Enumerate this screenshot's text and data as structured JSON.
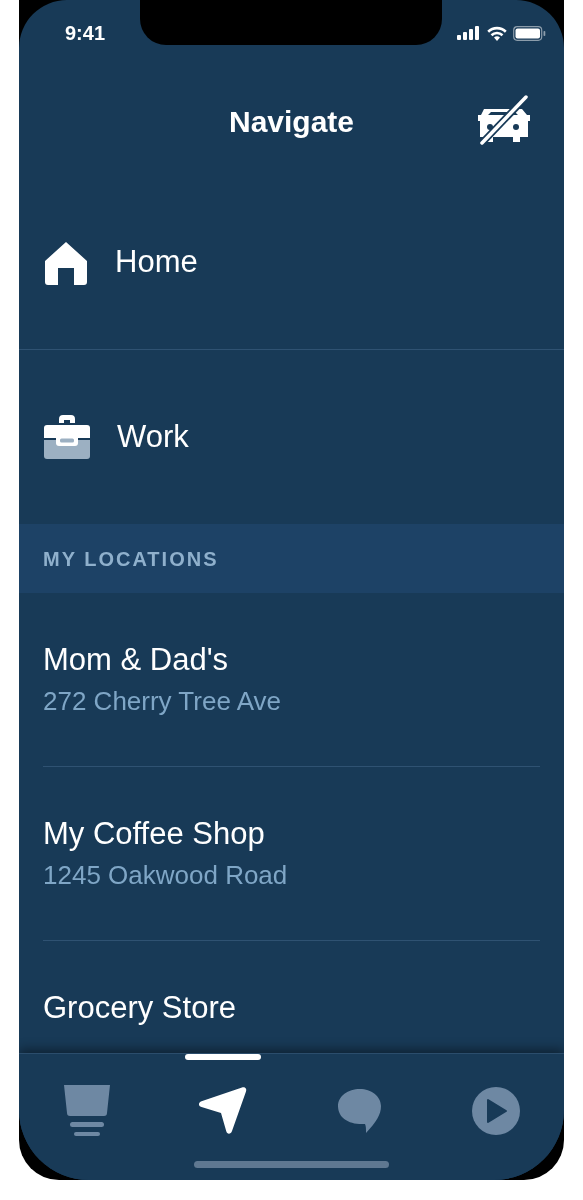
{
  "status_bar": {
    "time": "9:41"
  },
  "header": {
    "title": "Navigate"
  },
  "shortcuts": [
    {
      "kind": "home",
      "label": "Home"
    },
    {
      "kind": "work",
      "label": "Work"
    }
  ],
  "section": {
    "title": "MY LOCATIONS"
  },
  "locations": [
    {
      "name": "Mom & Dad's",
      "address": "272 Cherry Tree Ave"
    },
    {
      "name": "My Coffee Shop",
      "address": "1245 Oakwood Road"
    },
    {
      "name": "Grocery Store"
    }
  ],
  "tabs": [
    {
      "kind": "home",
      "selected": false
    },
    {
      "kind": "navigate",
      "selected": true
    },
    {
      "kind": "chat",
      "selected": false
    },
    {
      "kind": "play",
      "selected": false
    }
  ]
}
